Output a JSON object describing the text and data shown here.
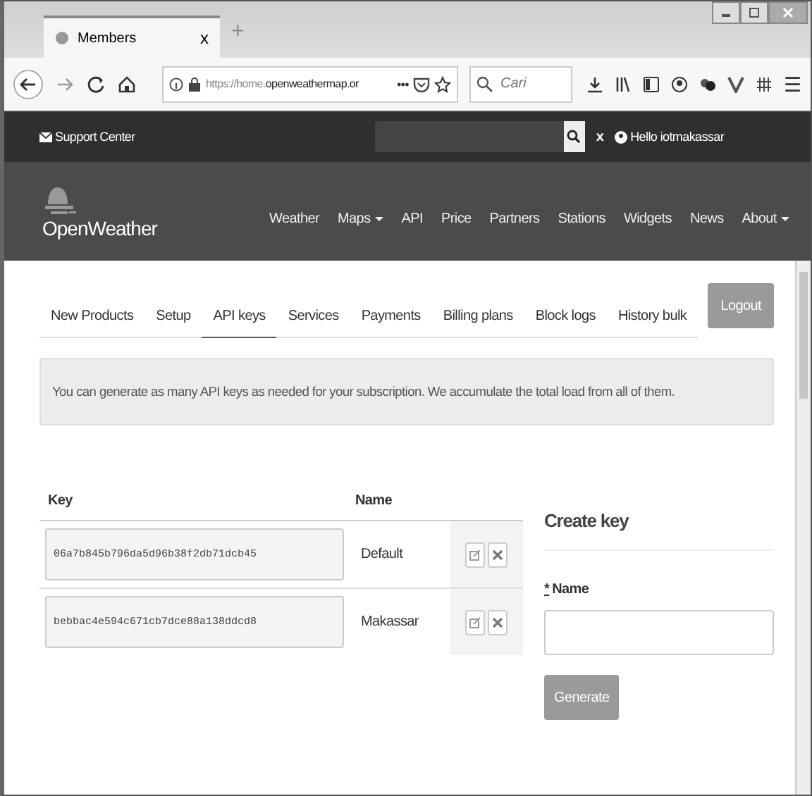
{
  "browser": {
    "tab_title": "Members",
    "tab_close": "x",
    "new_tab": "+",
    "url_prefix": "https://home.",
    "url_domain": "openweathermap.or",
    "page_actions": "•••",
    "search_placeholder": "Cari",
    "menu_glyph": "☰"
  },
  "topbar": {
    "support": "Support Center",
    "clear": "x",
    "greeting": "Hello iotmakassar"
  },
  "nav": {
    "logo": "OpenWeather",
    "items": [
      {
        "label": "Weather",
        "dropdown": false
      },
      {
        "label": "Maps",
        "dropdown": true
      },
      {
        "label": "API",
        "dropdown": false
      },
      {
        "label": "Price",
        "dropdown": false
      },
      {
        "label": "Partners",
        "dropdown": false
      },
      {
        "label": "Stations",
        "dropdown": false
      },
      {
        "label": "Widgets",
        "dropdown": false
      },
      {
        "label": "News",
        "dropdown": false
      },
      {
        "label": "About",
        "dropdown": true
      }
    ]
  },
  "tabs": [
    {
      "label": "New Products",
      "selected": false
    },
    {
      "label": "Setup",
      "selected": false
    },
    {
      "label": "API keys",
      "selected": true
    },
    {
      "label": "Services",
      "selected": false
    },
    {
      "label": "Payments",
      "selected": false
    },
    {
      "label": "Billing plans",
      "selected": false
    },
    {
      "label": "Block logs",
      "selected": false
    },
    {
      "label": "History bulk",
      "selected": false
    }
  ],
  "logout": "Logout",
  "notice": "You can generate as many API keys as needed for your subscription. We accumulate the total load from all of them.",
  "keys": {
    "columns": [
      "Key",
      "Name"
    ],
    "rows": [
      {
        "key": "06a7b845b796da5d96b38f2db71dcb45",
        "name": "Default"
      },
      {
        "key": "bebbac4e594c671cb7dce88a138ddcd8",
        "name": "Makassar"
      }
    ]
  },
  "create": {
    "title": "Create key",
    "required_mark": "*",
    "field_label": "Name",
    "button": "Generate"
  }
}
